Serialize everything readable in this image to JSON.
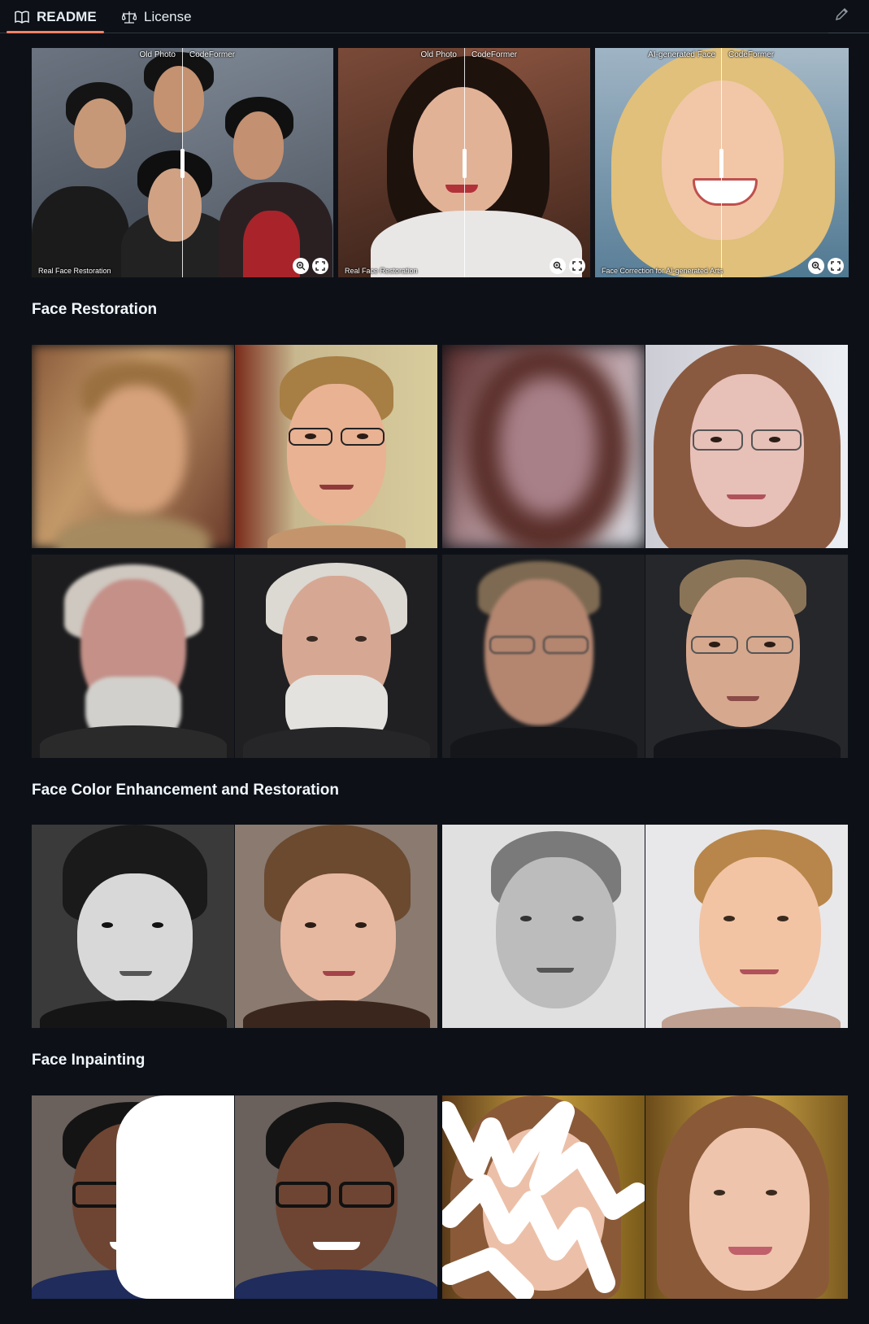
{
  "tabs": [
    {
      "label": "README",
      "icon": "book-icon",
      "active": true
    },
    {
      "label": "License",
      "icon": "law-icon",
      "active": false
    }
  ],
  "edit_icon": "pencil-icon",
  "accent_color": "#f78166",
  "showcase": [
    {
      "left_label": "Old Photo",
      "right_label": "CodeFormer",
      "caption": "Real Face Restoration"
    },
    {
      "left_label": "Old Photo",
      "right_label": "CodeFormer",
      "caption": "Real Face Restoration"
    },
    {
      "left_label": "AI-generated Face",
      "right_label": "CodeFormer",
      "caption": "Face Correction for AI-generated Arts"
    }
  ],
  "showcase_controls": [
    "zoom-in-icon",
    "fullscreen-icon"
  ],
  "sections": [
    {
      "title": "Face Restoration"
    },
    {
      "title": "Face Color Enhancement and Restoration"
    },
    {
      "title": "Face Inpainting"
    }
  ]
}
